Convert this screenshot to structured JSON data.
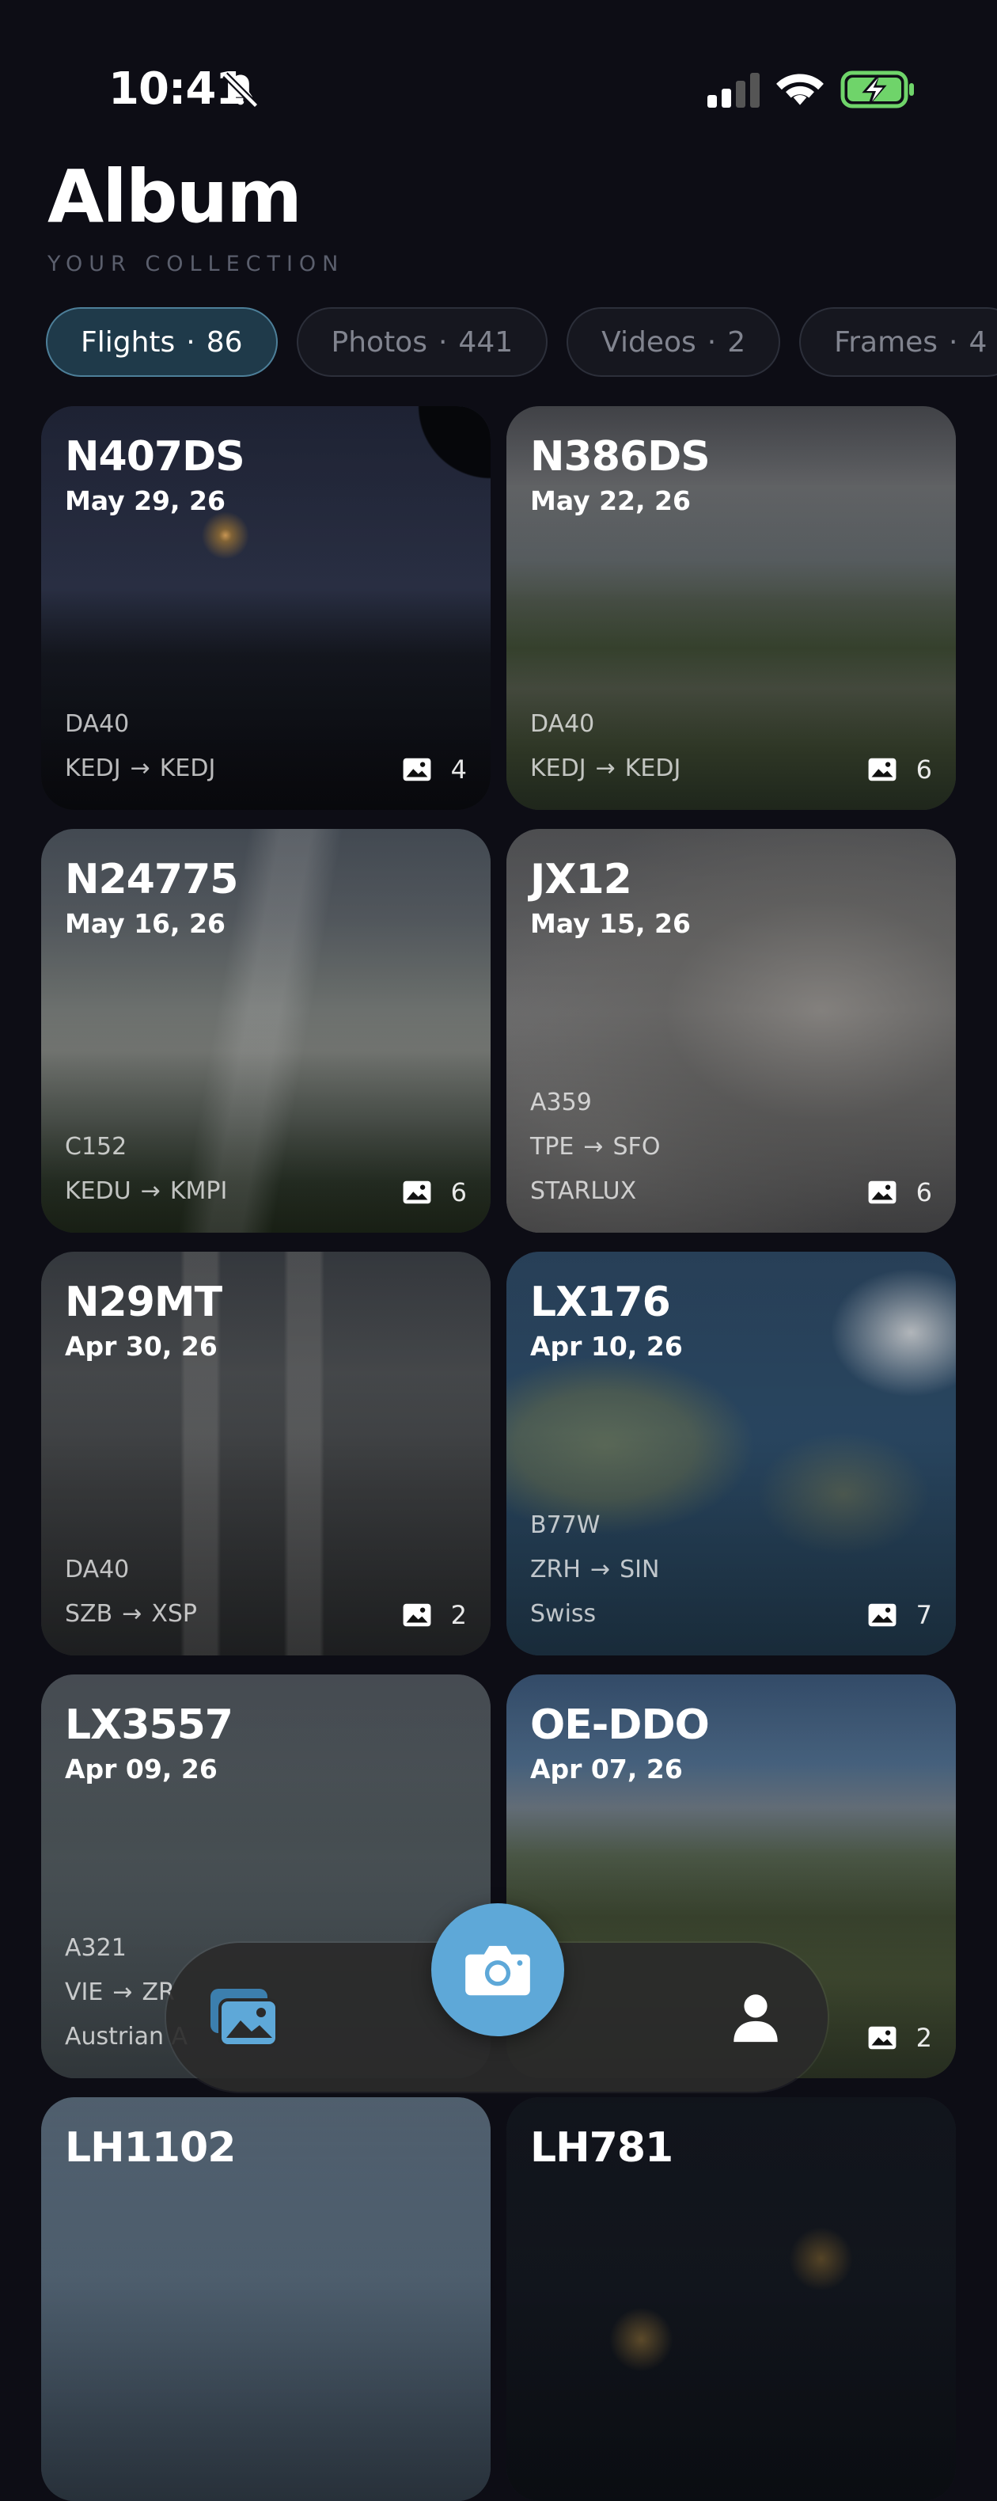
{
  "status_bar": {
    "time": "10:41"
  },
  "header": {
    "title": "Album",
    "subtitle": "YOUR COLLECTION"
  },
  "tabs": [
    {
      "label": "Flights",
      "count": "86"
    },
    {
      "label": "Photos",
      "count": "441"
    },
    {
      "label": "Videos",
      "count": "2"
    },
    {
      "label": "Frames",
      "count": "4"
    }
  ],
  "route_arrow": "→",
  "cards": [
    {
      "registration": "N407DS",
      "date": "May 29, 26",
      "aircraft": "DA40",
      "from": "KEDJ",
      "to": "KEDJ",
      "airline": "",
      "photos": "4"
    },
    {
      "registration": "N386DS",
      "date": "May 22, 26",
      "aircraft": "DA40",
      "from": "KEDJ",
      "to": "KEDJ",
      "airline": "",
      "photos": "6"
    },
    {
      "registration": "N24775",
      "date": "May 16, 26",
      "aircraft": "C152",
      "from": "KEDU",
      "to": "KMPI",
      "airline": "",
      "photos": "6"
    },
    {
      "registration": "JX12",
      "date": "May 15, 26",
      "aircraft": "A359",
      "from": "TPE",
      "to": "SFO",
      "airline": "STARLUX",
      "photos": "6"
    },
    {
      "registration": "N29MT",
      "date": "Apr 30, 26",
      "aircraft": "DA40",
      "from": "SZB",
      "to": "XSP",
      "airline": "",
      "photos": "2"
    },
    {
      "registration": "LX176",
      "date": "Apr 10, 26",
      "aircraft": "B77W",
      "from": "ZRH",
      "to": "SIN",
      "airline": "Swiss",
      "photos": "7"
    },
    {
      "registration": "LX3557",
      "date": "Apr 09, 26",
      "aircraft": "A321",
      "from": "VIE",
      "to": "ZR",
      "airline": "Austrian A",
      "photos": ""
    },
    {
      "registration": "OE-DDO",
      "date": "Apr 07, 26",
      "aircraft": "",
      "from": "",
      "to": "",
      "airline": "",
      "photos": "2"
    },
    {
      "registration": "LH1102",
      "date": "",
      "aircraft": "",
      "from": "",
      "to": "",
      "airline": "",
      "photos": ""
    },
    {
      "registration": "LH781",
      "date": "",
      "aircraft": "",
      "from": "",
      "to": "",
      "airline": "",
      "photos": ""
    }
  ],
  "icons": {
    "photo_count": "image-icon",
    "nav_gallery": "gallery-icon",
    "nav_camera": "camera-icon",
    "nav_profile": "profile-icon"
  },
  "colors": {
    "background": "#0d0d15",
    "accent": "#5ea8d8",
    "active_tab": "#1f3a4a",
    "battery_fill": "#6fd46a"
  }
}
